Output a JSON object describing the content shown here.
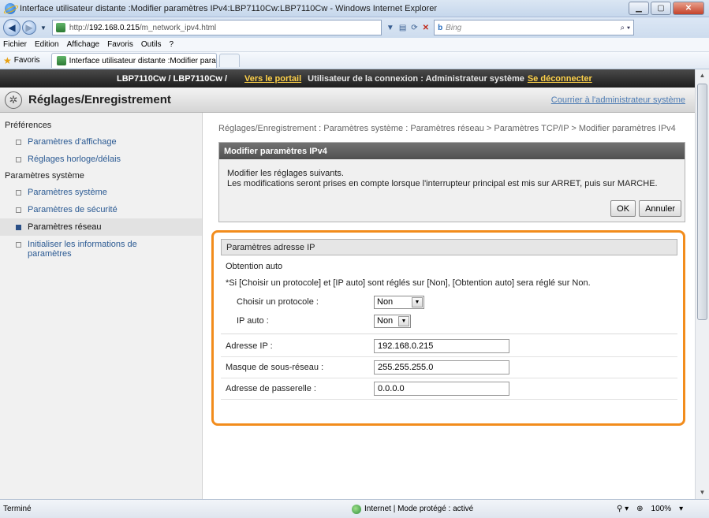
{
  "window": {
    "title": "Interface utilisateur distante :Modifier paramètres IPv4:LBP7110Cw:LBP7110Cw - Windows Internet Explorer"
  },
  "address": {
    "url_prefix": "http://",
    "url_host": "192.168.0.215",
    "url_path": "/m_network_ipv4.html",
    "search_placeholder": "Bing",
    "search_engine": "b"
  },
  "menu": [
    "Fichier",
    "Edition",
    "Affichage",
    "Favoris",
    "Outils",
    "?"
  ],
  "favorites": {
    "label": "Favoris",
    "tab_title": "Interface utilisateur distante :Modifier paramètres..."
  },
  "printer_bar": {
    "device": "LBP7110Cw / LBP7110Cw /",
    "portal": "Vers le portail",
    "user": "Utilisateur de la connexion : Administrateur système",
    "logout": "Se déconnecter"
  },
  "section": {
    "title": "Réglages/Enregistrement",
    "admin_mail": "Courrier à l'administrateur système"
  },
  "sidebar": {
    "group1": "Préférences",
    "group1_items": [
      "Paramètres d'affichage",
      "Réglages horloge/délais"
    ],
    "group2": "Paramètres système",
    "group2_items": [
      "Paramètres système",
      "Paramètres de sécurité",
      "Paramètres réseau",
      "Initialiser les informations de paramètres"
    ],
    "active_item": "Paramètres réseau"
  },
  "main": {
    "breadcrumb": "Réglages/Enregistrement : Paramètres système : Paramètres réseau > Paramètres TCP/IP > Modifier paramètres IPv4",
    "panel_title": "Modifier paramètres IPv4",
    "panel_line1": "Modifier les réglages suivants.",
    "panel_line2": "Les modifications seront prises en compte lorsque l'interrupteur principal est mis sur ARRET, puis sur MARCHE.",
    "ok_label": "OK",
    "cancel_label": "Annuler"
  },
  "ip_settings": {
    "header": "Paramètres adresse IP",
    "auto_title": "Obtention auto",
    "note": "*Si [Choisir un protocole] et [IP auto] sont réglés sur [Non], [Obtention auto] sera réglé sur Non.",
    "protocol_label": "Choisir un protocole :",
    "protocol_value": "Non",
    "auto_ip_label": "IP auto :",
    "auto_ip_value": "Non",
    "ip_label": "Adresse IP :",
    "ip_value": "192.168.0.215",
    "mask_label": "Masque de sous-réseau :",
    "mask_value": "255.255.255.0",
    "gateway_label": "Adresse de passerelle :",
    "gateway_value": "0.0.0.0"
  },
  "status": {
    "left": "Terminé",
    "zone": "Internet | Mode protégé : activé",
    "zoom": "100%"
  }
}
